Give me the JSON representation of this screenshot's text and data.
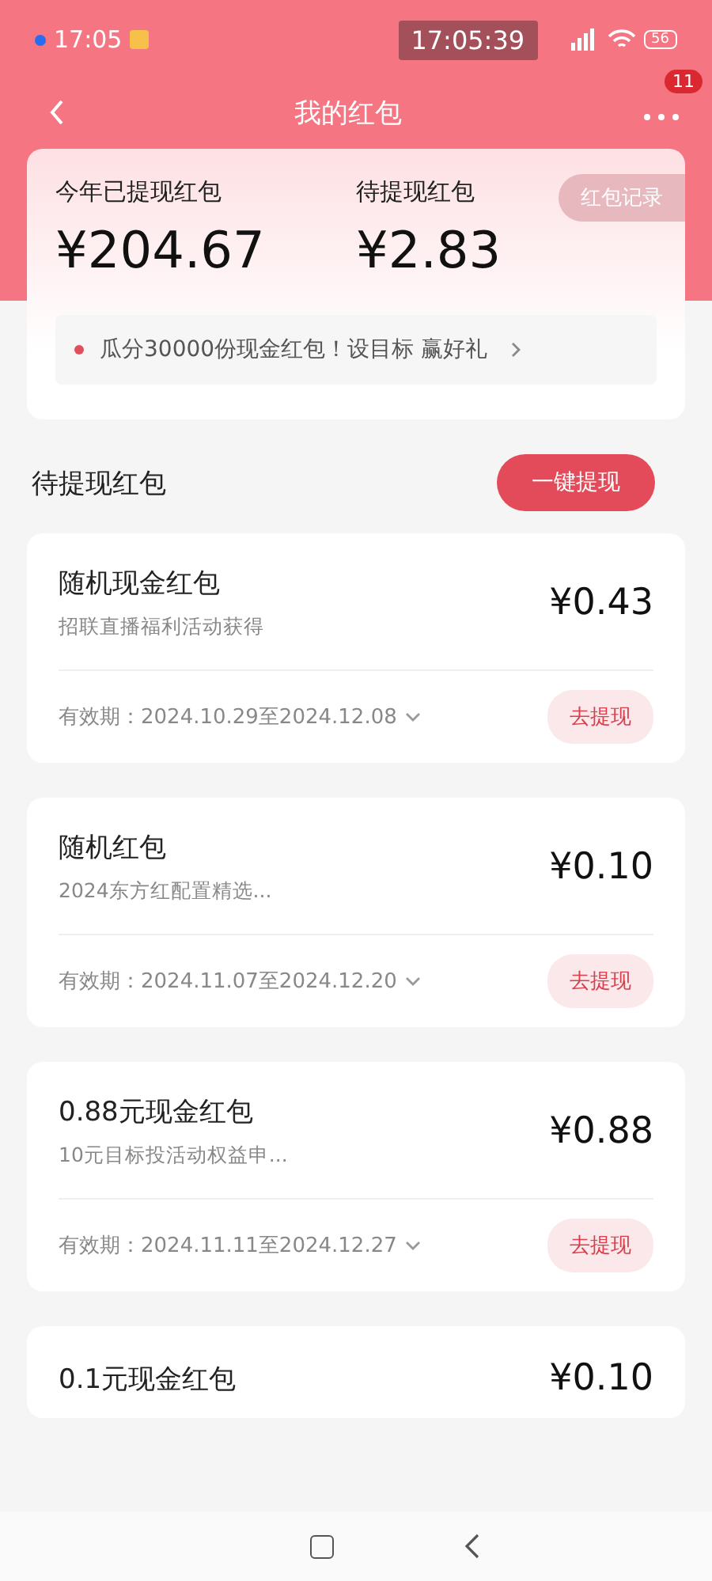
{
  "status_bar": {
    "time": "17:05",
    "clock_badge": "17:05:39",
    "battery": "56"
  },
  "header": {
    "title": "我的红包",
    "badge": "11"
  },
  "summary": {
    "record_button": "红包记录",
    "stats": [
      {
        "label": "今年已提现红包",
        "value": "¥204.67"
      },
      {
        "label": "待提现红包",
        "value": "¥2.83"
      }
    ],
    "promo": "瓜分30000份现金红包！设目标 赢好礼"
  },
  "section": {
    "title": "待提现红包",
    "button": "一键提现"
  },
  "packets": [
    {
      "title": "随机现金红包",
      "subtitle": "招联直播福利活动获得",
      "amount": "¥0.43",
      "validity": "有效期：2024.10.29至2024.12.08",
      "action": "去提现"
    },
    {
      "title": "随机红包",
      "subtitle": "2024东方红配置精选...",
      "amount": "¥0.10",
      "validity": "有效期：2024.11.07至2024.12.20",
      "action": "去提现"
    },
    {
      "title": "0.88元现金红包",
      "subtitle": "10元目标投活动权益申...",
      "amount": "¥0.88",
      "validity": "有效期：2024.11.11至2024.12.27",
      "action": "去提现"
    },
    {
      "title": "0.1元现金红包",
      "amount": "¥0.10"
    }
  ]
}
